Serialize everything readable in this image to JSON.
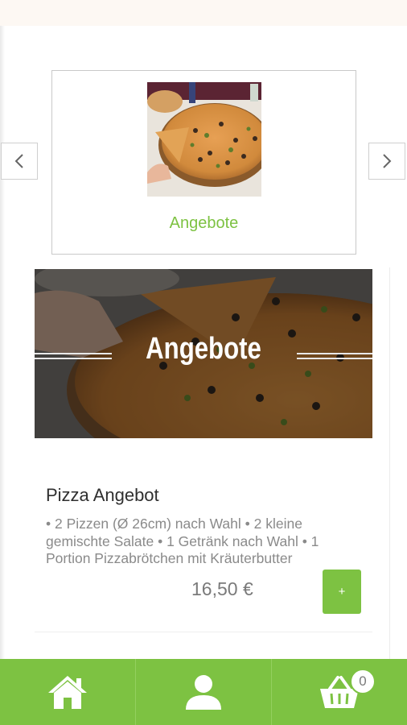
{
  "category_slider": {
    "active_category": "Angebote"
  },
  "banner": {
    "title": "Angebote"
  },
  "item": {
    "name": "Pizza Angebot",
    "description": "• 2 Pizzen (Ø 26cm) nach Wahl • 2 kleine gemischte Salate • 1 Getränk nach Wahl • 1 Portion Pizzabrötchen mit Kräuterbutter",
    "price": "16,50 €",
    "add_label": "+"
  },
  "bottom_nav": {
    "tabs": [
      {
        "icon": "home-icon"
      },
      {
        "icon": "user-icon"
      },
      {
        "icon": "cart-icon"
      }
    ],
    "cart_count": "0"
  },
  "colors": {
    "accent": "#7dc242",
    "top_bar": "#fdf8f3"
  }
}
